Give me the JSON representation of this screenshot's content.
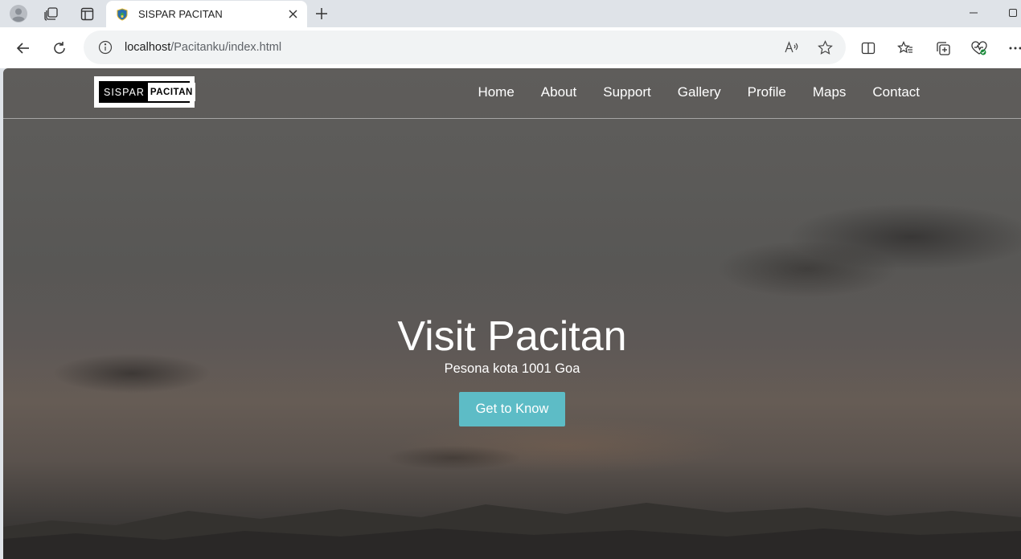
{
  "browser": {
    "tab": {
      "title": "SISPAR PACITAN"
    },
    "address": {
      "host": "localhost",
      "path": "/Pacitanku/index.html"
    }
  },
  "site": {
    "logo": {
      "part1": "SISPAR",
      "part2": "PACITAN"
    },
    "nav": [
      "Home",
      "About",
      "Support",
      "Gallery",
      "Profile",
      "Maps",
      "Contact"
    ],
    "hero": {
      "title": "Visit Pacitan",
      "subtitle": "Pesona kota 1001 Goa",
      "cta": "Get to Know"
    },
    "colors": {
      "cta": "#5dbcc6",
      "nav_text": "#ffffff"
    }
  },
  "icons": [
    "profile-icon",
    "workspaces-icon",
    "tab-actions-icon",
    "shield-favicon",
    "close-icon",
    "plus-icon",
    "minimize-icon",
    "maximize-icon",
    "back-icon",
    "refresh-icon",
    "info-icon",
    "read-aloud-icon",
    "star-icon",
    "split-screen-icon",
    "favorites-icon",
    "collections-icon",
    "health-icon",
    "more-icon"
  ]
}
